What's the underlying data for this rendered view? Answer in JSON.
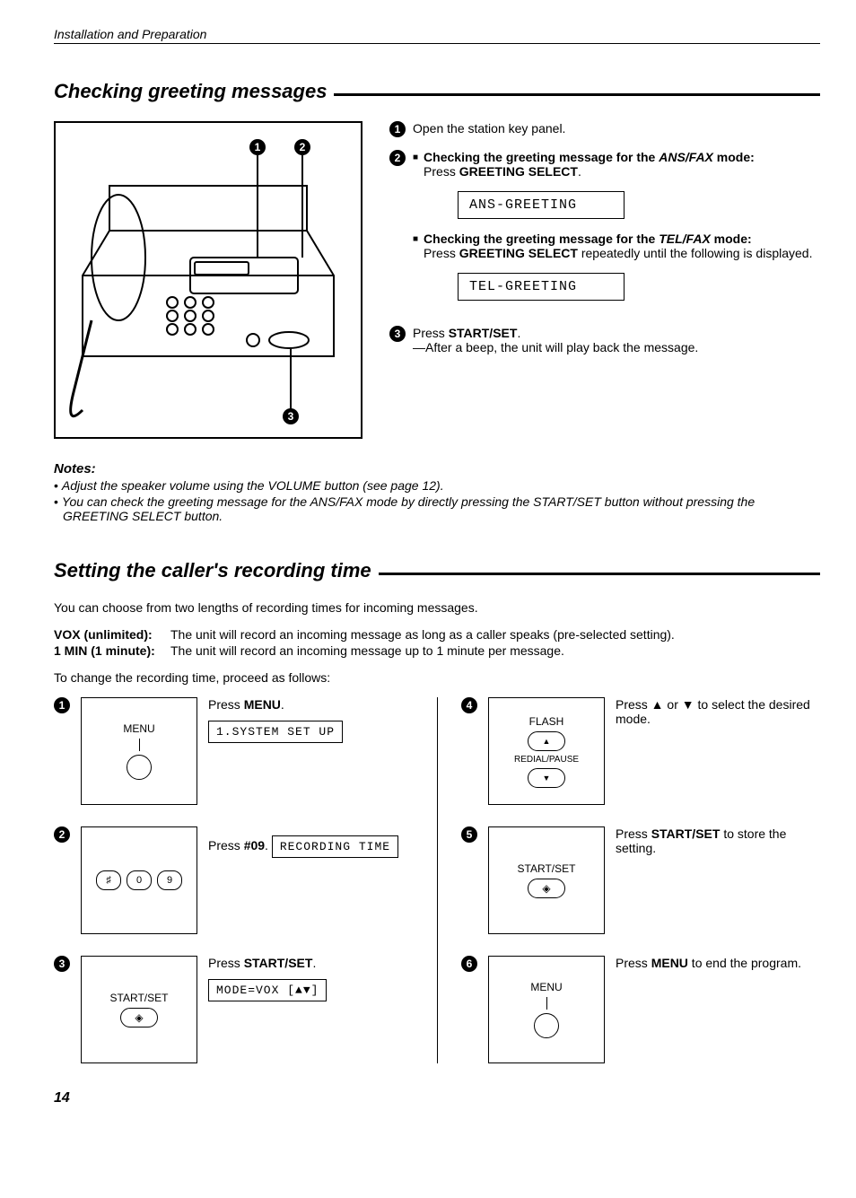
{
  "header": "Installation and Preparation",
  "section1": {
    "title": "Checking greeting messages",
    "steps": {
      "s1": "Open the station key panel.",
      "s2a_lead": "Checking the greeting message for the ",
      "s2a_mode": "ANS/FAX",
      "s2a_mode_word": " mode:",
      "s2a_action_pre": "Press ",
      "s2a_action_btn": "GREETING SELECT",
      "s2a_action_post": ".",
      "lcd1": "ANS-GREETING",
      "s2b_lead": "Checking the greeting message for the ",
      "s2b_mode": "TEL/FAX",
      "s2b_mode_word": " mode:",
      "s2b_action_pre": "Press ",
      "s2b_action_btn": "GREETING SELECT",
      "s2b_action_post": " repeatedly until the following is displayed.",
      "lcd2": "TEL-GREETING",
      "s3_pre": "Press ",
      "s3_btn": "START/SET",
      "s3_post": ".",
      "s3_sub": "—After a beep, the unit will play back the message."
    },
    "notes_h": "Notes:",
    "notes": [
      "Adjust the speaker volume using the VOLUME button (see page 12).",
      "You can check the greeting message for the ANS/FAX mode by directly pressing the START/SET button without pressing the GREETING SELECT button."
    ]
  },
  "section2": {
    "title": "Setting the caller's recording time",
    "intro": "You can choose from two lengths of recording times for incoming messages.",
    "defs": [
      {
        "term": "VOX (unlimited):",
        "desc": "The unit will record an incoming message as long as a caller speaks (pre-selected setting)."
      },
      {
        "term": "1 MIN (1 minute):",
        "desc": "The unit will record an incoming message up to 1 minute per message."
      }
    ],
    "intro2": "To change the recording time, proceed as follows:",
    "grid": {
      "b1_label": "MENU",
      "i1_pre": "Press ",
      "i1_btn": "MENU",
      "i1_post": ".",
      "i1_lcd": "1.SYSTEM SET UP",
      "b2_k1": "♯",
      "b2_k2": "0",
      "b2_k3": "9",
      "i2_pre": "Press ",
      "i2_btn": "#09",
      "i2_post": ".",
      "i2_lcd": "RECORDING TIME",
      "b3_label": "START/SET",
      "i3_pre": "Press ",
      "i3_btn": "START/SET",
      "i3_post": ".",
      "i3_lcd": "MODE=VOX   [▲▼]",
      "b4_l1": "FLASH",
      "b4_l2": "REDIAL/PAUSE",
      "i4": "Press ▲ or ▼ to select the desired mode.",
      "b5_label": "START/SET",
      "i5_pre": "Press ",
      "i5_btn": "START/SET",
      "i5_post": " to store the setting.",
      "b6_label": "MENU",
      "i6_pre": "Press ",
      "i6_btn": "MENU",
      "i6_post": " to end the program."
    }
  },
  "pagenum": "14"
}
